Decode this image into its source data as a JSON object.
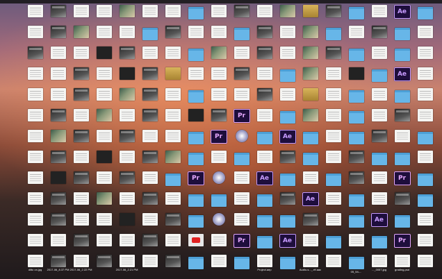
{
  "desktop": {
    "icons": [
      {
        "type": "doc",
        "label": ""
      },
      {
        "type": "shot",
        "label": ""
      },
      {
        "type": "doc",
        "label": ""
      },
      {
        "type": "doc",
        "label": ""
      },
      {
        "type": "photo",
        "label": ""
      },
      {
        "type": "doc",
        "label": ""
      },
      {
        "type": "doc",
        "label": ""
      },
      {
        "type": "folder",
        "label": ""
      },
      {
        "type": "doc",
        "label": ""
      },
      {
        "type": "shot",
        "label": ""
      },
      {
        "type": "doc",
        "label": ""
      },
      {
        "type": "photo",
        "label": ""
      },
      {
        "type": "gold",
        "label": ""
      },
      {
        "type": "shot",
        "label": ""
      },
      {
        "type": "folder",
        "label": ""
      },
      {
        "type": "doc",
        "label": ""
      },
      {
        "type": "ae",
        "label": ""
      },
      {
        "type": "folder",
        "label": ""
      },
      {
        "type": "doc",
        "label": ""
      },
      {
        "type": "shot",
        "label": ""
      },
      {
        "type": "photo",
        "label": ""
      },
      {
        "type": "doc",
        "label": ""
      },
      {
        "type": "doc",
        "label": ""
      },
      {
        "type": "folder",
        "label": ""
      },
      {
        "type": "shot",
        "label": ""
      },
      {
        "type": "doc",
        "label": ""
      },
      {
        "type": "doc",
        "label": ""
      },
      {
        "type": "folder",
        "label": ""
      },
      {
        "type": "shot",
        "label": ""
      },
      {
        "type": "doc",
        "label": ""
      },
      {
        "type": "photo",
        "label": ""
      },
      {
        "type": "folder",
        "label": ""
      },
      {
        "type": "doc",
        "label": ""
      },
      {
        "type": "shot",
        "label": ""
      },
      {
        "type": "folder",
        "label": ""
      },
      {
        "type": "doc",
        "label": ""
      },
      {
        "type": "shot",
        "label": ""
      },
      {
        "type": "doc",
        "label": ""
      },
      {
        "type": "doc",
        "label": ""
      },
      {
        "type": "dark",
        "label": ""
      },
      {
        "type": "shot",
        "label": ""
      },
      {
        "type": "doc",
        "label": ""
      },
      {
        "type": "doc",
        "label": ""
      },
      {
        "type": "folder",
        "label": ""
      },
      {
        "type": "photo",
        "label": ""
      },
      {
        "type": "doc",
        "label": ""
      },
      {
        "type": "shot",
        "label": ""
      },
      {
        "type": "doc",
        "label": ""
      },
      {
        "type": "photo",
        "label": ""
      },
      {
        "type": "shot",
        "label": ""
      },
      {
        "type": "folder",
        "label": ""
      },
      {
        "type": "doc",
        "label": ""
      },
      {
        "type": "folder",
        "label": ""
      },
      {
        "type": "doc",
        "label": ""
      },
      {
        "type": "doc",
        "label": ""
      },
      {
        "type": "doc",
        "label": ""
      },
      {
        "type": "shot",
        "label": ""
      },
      {
        "type": "doc",
        "label": ""
      },
      {
        "type": "dark",
        "label": ""
      },
      {
        "type": "shot",
        "label": ""
      },
      {
        "type": "gold",
        "label": ""
      },
      {
        "type": "doc",
        "label": ""
      },
      {
        "type": "doc",
        "label": ""
      },
      {
        "type": "shot",
        "label": ""
      },
      {
        "type": "doc",
        "label": ""
      },
      {
        "type": "folder",
        "label": ""
      },
      {
        "type": "photo",
        "label": ""
      },
      {
        "type": "doc",
        "label": ""
      },
      {
        "type": "dark",
        "label": ""
      },
      {
        "type": "folder",
        "label": ""
      },
      {
        "type": "ae",
        "label": ""
      },
      {
        "type": "doc",
        "label": ""
      },
      {
        "type": "doc",
        "label": ""
      },
      {
        "type": "doc",
        "label": ""
      },
      {
        "type": "shot",
        "label": ""
      },
      {
        "type": "doc",
        "label": ""
      },
      {
        "type": "photo",
        "label": ""
      },
      {
        "type": "shot",
        "label": ""
      },
      {
        "type": "doc",
        "label": ""
      },
      {
        "type": "folder",
        "label": ""
      },
      {
        "type": "doc",
        "label": ""
      },
      {
        "type": "doc",
        "label": ""
      },
      {
        "type": "shot",
        "label": ""
      },
      {
        "type": "doc",
        "label": ""
      },
      {
        "type": "gold",
        "label": ""
      },
      {
        "type": "doc",
        "label": ""
      },
      {
        "type": "folder",
        "label": ""
      },
      {
        "type": "doc",
        "label": ""
      },
      {
        "type": "folder",
        "label": ""
      },
      {
        "type": "doc",
        "label": ""
      },
      {
        "type": "doc",
        "label": ""
      },
      {
        "type": "shot",
        "label": ""
      },
      {
        "type": "doc",
        "label": ""
      },
      {
        "type": "photo",
        "label": ""
      },
      {
        "type": "doc",
        "label": ""
      },
      {
        "type": "shot",
        "label": ""
      },
      {
        "type": "doc",
        "label": ""
      },
      {
        "type": "dark",
        "label": ""
      },
      {
        "type": "shot",
        "label": ""
      },
      {
        "type": "pr",
        "label": ""
      },
      {
        "type": "doc",
        "label": ""
      },
      {
        "type": "folder",
        "label": ""
      },
      {
        "type": "photo",
        "label": ""
      },
      {
        "type": "doc",
        "label": ""
      },
      {
        "type": "folder",
        "label": ""
      },
      {
        "type": "doc",
        "label": ""
      },
      {
        "type": "shot",
        "label": ""
      },
      {
        "type": "doc",
        "label": ""
      },
      {
        "type": "doc",
        "label": ""
      },
      {
        "type": "photo",
        "label": ""
      },
      {
        "type": "shot",
        "label": ""
      },
      {
        "type": "doc",
        "label": ""
      },
      {
        "type": "shot",
        "label": ""
      },
      {
        "type": "doc",
        "label": ""
      },
      {
        "type": "doc",
        "label": ""
      },
      {
        "type": "folder",
        "label": ""
      },
      {
        "type": "pr",
        "label": ""
      },
      {
        "type": "app",
        "label": ""
      },
      {
        "type": "folder",
        "label": ""
      },
      {
        "type": "ae",
        "label": ""
      },
      {
        "type": "folder",
        "label": ""
      },
      {
        "type": "doc",
        "label": ""
      },
      {
        "type": "folder",
        "label": ""
      },
      {
        "type": "shot",
        "label": ""
      },
      {
        "type": "doc",
        "label": ""
      },
      {
        "type": "folder",
        "label": ""
      },
      {
        "type": "doc",
        "label": ""
      },
      {
        "type": "shot",
        "label": ""
      },
      {
        "type": "doc",
        "label": ""
      },
      {
        "type": "dark",
        "label": ""
      },
      {
        "type": "doc",
        "label": ""
      },
      {
        "type": "shot",
        "label": ""
      },
      {
        "type": "photo",
        "label": ""
      },
      {
        "type": "folder",
        "label": ""
      },
      {
        "type": "doc",
        "label": ""
      },
      {
        "type": "folder",
        "label": ""
      },
      {
        "type": "doc",
        "label": ""
      },
      {
        "type": "shot",
        "label": ""
      },
      {
        "type": "folder",
        "label": ""
      },
      {
        "type": "doc",
        "label": ""
      },
      {
        "type": "shot",
        "label": ""
      },
      {
        "type": "folder",
        "label": ""
      },
      {
        "type": "folder",
        "label": ""
      },
      {
        "type": "doc",
        "label": ""
      },
      {
        "type": "doc",
        "label": ""
      },
      {
        "type": "dark",
        "label": ""
      },
      {
        "type": "shot",
        "label": ""
      },
      {
        "type": "doc",
        "label": ""
      },
      {
        "type": "shot",
        "label": ""
      },
      {
        "type": "doc",
        "label": ""
      },
      {
        "type": "folder",
        "label": ""
      },
      {
        "type": "pr",
        "label": ""
      },
      {
        "type": "app",
        "label": ""
      },
      {
        "type": "doc",
        "label": ""
      },
      {
        "type": "ae",
        "label": ""
      },
      {
        "type": "folder",
        "label": ""
      },
      {
        "type": "doc",
        "label": ""
      },
      {
        "type": "folder",
        "label": ""
      },
      {
        "type": "shot",
        "label": ""
      },
      {
        "type": "doc",
        "label": ""
      },
      {
        "type": "pr",
        "label": ""
      },
      {
        "type": "folder",
        "label": ""
      },
      {
        "type": "doc",
        "label": ""
      },
      {
        "type": "shot",
        "label": ""
      },
      {
        "type": "doc",
        "label": ""
      },
      {
        "type": "photo",
        "label": ""
      },
      {
        "type": "doc",
        "label": ""
      },
      {
        "type": "shot",
        "label": ""
      },
      {
        "type": "doc",
        "label": ""
      },
      {
        "type": "folder",
        "label": ""
      },
      {
        "type": "folder",
        "label": ""
      },
      {
        "type": "doc",
        "label": ""
      },
      {
        "type": "folder",
        "label": ""
      },
      {
        "type": "shot",
        "label": ""
      },
      {
        "type": "ae",
        "label": ""
      },
      {
        "type": "doc",
        "label": ""
      },
      {
        "type": "folder",
        "label": ""
      },
      {
        "type": "doc",
        "label": ""
      },
      {
        "type": "shot",
        "label": ""
      },
      {
        "type": "folder",
        "label": ""
      },
      {
        "type": "doc",
        "label": ""
      },
      {
        "type": "shot",
        "label": ""
      },
      {
        "type": "doc",
        "label": ""
      },
      {
        "type": "doc",
        "label": ""
      },
      {
        "type": "dark",
        "label": ""
      },
      {
        "type": "doc",
        "label": ""
      },
      {
        "type": "shot",
        "label": ""
      },
      {
        "type": "folder",
        "label": ""
      },
      {
        "type": "app",
        "label": ""
      },
      {
        "type": "doc",
        "label": ""
      },
      {
        "type": "folder",
        "label": ""
      },
      {
        "type": "folder",
        "label": ""
      },
      {
        "type": "shot",
        "label": ""
      },
      {
        "type": "doc",
        "label": ""
      },
      {
        "type": "folder",
        "label": ""
      },
      {
        "type": "ae",
        "label": ""
      },
      {
        "type": "folder",
        "label": ""
      },
      {
        "type": "doc",
        "label": ""
      },
      {
        "type": "doc",
        "label": ""
      },
      {
        "type": "doc",
        "label": ""
      },
      {
        "type": "shot",
        "label": ""
      },
      {
        "type": "doc",
        "label": ""
      },
      {
        "type": "doc",
        "label": ""
      },
      {
        "type": "shot",
        "label": ""
      },
      {
        "type": "doc",
        "label": ""
      },
      {
        "type": "yt",
        "label": ""
      },
      {
        "type": "doc",
        "label": ""
      },
      {
        "type": "pr",
        "label": ""
      },
      {
        "type": "folder",
        "label": ""
      },
      {
        "type": "ae",
        "label": ""
      },
      {
        "type": "doc",
        "label": ""
      },
      {
        "type": "folder",
        "label": ""
      },
      {
        "type": "doc",
        "label": ""
      },
      {
        "type": "folder",
        "label": ""
      },
      {
        "type": "pr",
        "label": ""
      },
      {
        "type": "doc",
        "label": ""
      },
      {
        "type": "doc",
        "label": "ditto on.jpg"
      },
      {
        "type": "shot",
        "label": "2017-06_8.37 PM"
      },
      {
        "type": "doc",
        "label": "2017-06_2.22 PM"
      },
      {
        "type": "shot",
        "label": ""
      },
      {
        "type": "doc",
        "label": "2017-06_2.21 PM"
      },
      {
        "type": "doc",
        "label": ""
      },
      {
        "type": "shot",
        "label": ""
      },
      {
        "type": "folder",
        "label": ""
      },
      {
        "type": "doc",
        "label": ""
      },
      {
        "type": "folder",
        "label": ""
      },
      {
        "type": "doc",
        "label": "Project.aep"
      },
      {
        "type": "folder",
        "label": ""
      },
      {
        "type": "doc",
        "label": "Audio-s..._.rtf.aac"
      },
      {
        "type": "doc",
        "label": ""
      },
      {
        "type": "folder",
        "label": "05_54-..."
      },
      {
        "type": "doc",
        "label": "..._0057.jpg"
      },
      {
        "type": "doc",
        "label": "grading.psd"
      },
      {
        "type": "doc",
        "label": ""
      }
    ]
  },
  "wallpaper": {
    "name": "macOS Sierra mountain"
  }
}
